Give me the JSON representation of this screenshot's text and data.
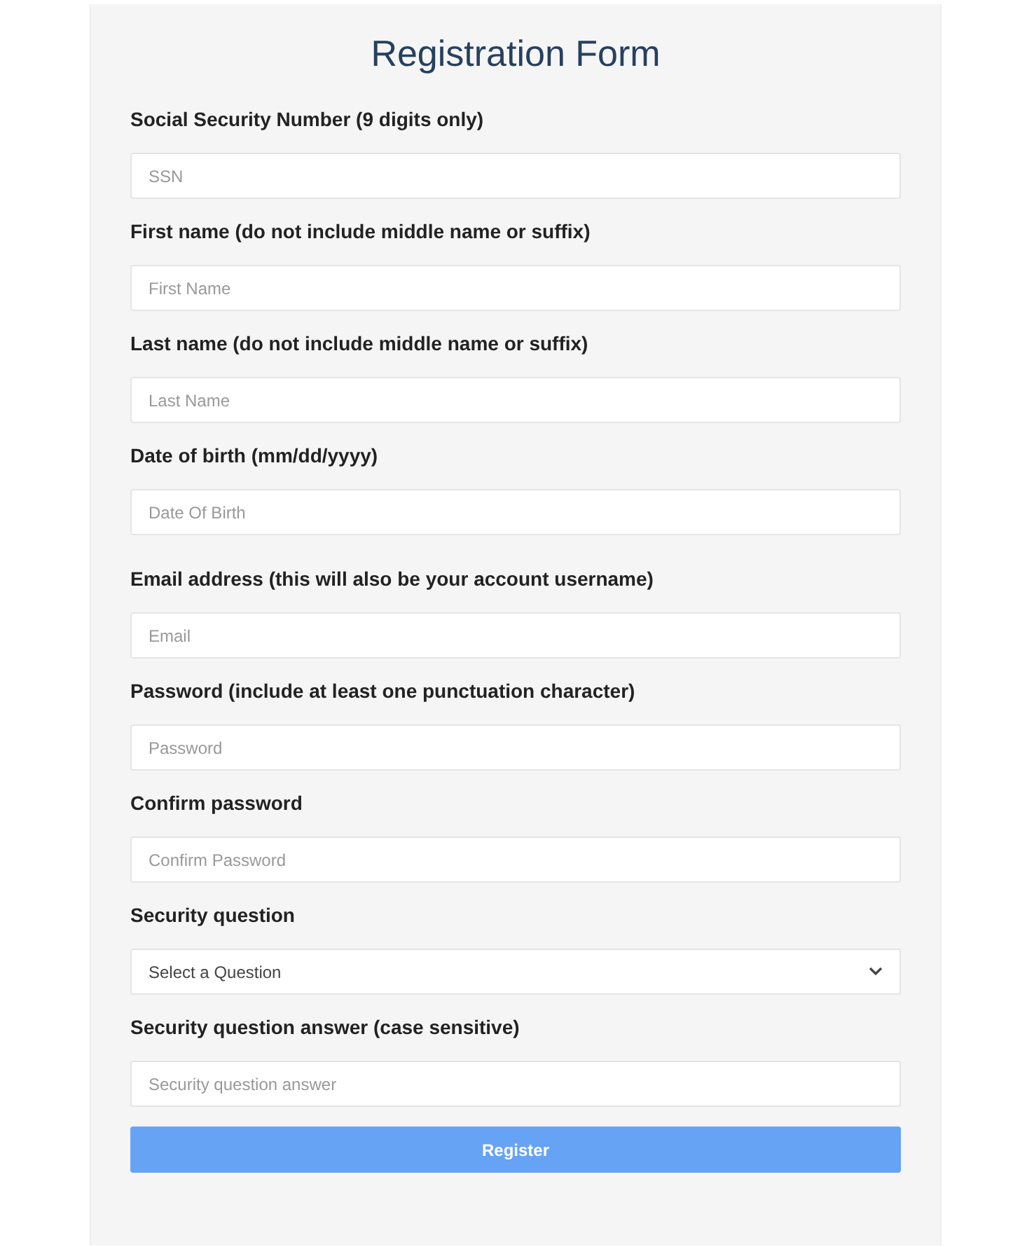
{
  "title": "Registration Form",
  "sections": [
    {
      "fields": [
        {
          "kind": "text",
          "label": "Social Security Number (9 digits only)",
          "placeholder": "SSN"
        },
        {
          "kind": "text",
          "label": "First name (do not include middle name or suffix)",
          "placeholder": "First Name"
        },
        {
          "kind": "text",
          "label": "Last name (do not include middle name or suffix)",
          "placeholder": "Last Name"
        },
        {
          "kind": "text",
          "label": "Date of birth (mm/dd/yyyy)",
          "placeholder": "Date Of Birth"
        }
      ]
    },
    {
      "fields": [
        {
          "kind": "text",
          "label": "Email address (this will also be your account username)",
          "placeholder": "Email"
        },
        {
          "kind": "text",
          "label": "Password (include at least one punctuation character)",
          "placeholder": "Password"
        },
        {
          "kind": "text",
          "label": "Confirm password",
          "placeholder": "Confirm Password"
        },
        {
          "kind": "select",
          "label": "Security question",
          "value": "Select a Question"
        },
        {
          "kind": "text",
          "label": "Security question answer (case sensitive)",
          "placeholder": "Security question answer"
        }
      ]
    }
  ],
  "button": "Register"
}
